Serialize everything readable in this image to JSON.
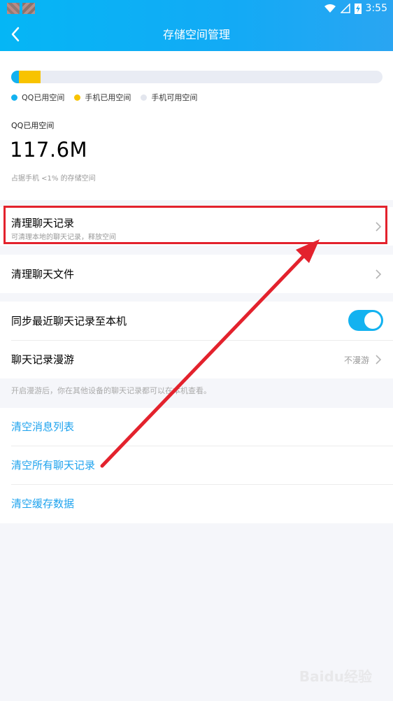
{
  "status_bar": {
    "time": "3:55"
  },
  "header": {
    "title": "存储空间管理"
  },
  "storage": {
    "qq_fraction": 0.02,
    "phone_fraction": 0.06,
    "colors": {
      "qq": "#13b2f0",
      "phone": "#f8c300",
      "free": "#e9ecf4"
    },
    "legend": [
      "QQ已用空间",
      "手机已用空间",
      "手机可用空间"
    ],
    "used_label": "QQ已用空间",
    "used_value": "117.6M",
    "used_note": "占据手机 <1% 的存储空间"
  },
  "rows": {
    "clean_chat_records": {
      "label": "清理聊天记录",
      "sub": "可清理本地的聊天记录，释放空间"
    },
    "clean_chat_files": {
      "label": "清理聊天文件"
    },
    "sync_records": {
      "label": "同步最近聊天记录至本机",
      "enabled": true
    },
    "roaming": {
      "label": "聊天记录漫游",
      "value": "不漫游"
    }
  },
  "hint": "开启漫游后，你在其他设备的聊天记录都可以在本机查看。",
  "links": {
    "clear_message_list": "清空消息列表",
    "clear_all_chats": "清空所有聊天记录",
    "clear_cache": "清空缓存数据"
  },
  "watermark": "Baidu经验",
  "annotation_color": "#e3222d"
}
